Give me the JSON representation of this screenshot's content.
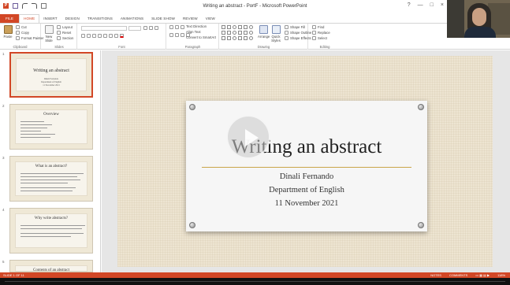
{
  "window": {
    "title": "Writing an abstract - PortF - Microsoft PowerPoint",
    "app_icon": "P",
    "controls": [
      "?",
      "—",
      "□",
      "×"
    ]
  },
  "ribbon": {
    "tabs": [
      "FILE",
      "HOME",
      "INSERT",
      "DESIGN",
      "TRANSITIONS",
      "ANIMATIONS",
      "SLIDE SHOW",
      "REVIEW",
      "VIEW"
    ],
    "active_tab": "HOME",
    "clipboard": {
      "paste": "Paste",
      "cut": "Cut",
      "copy": "Copy",
      "format_painter": "Format Painter",
      "label": "Clipboard"
    },
    "slides": {
      "new_slide": "New Slide",
      "layout": "Layout",
      "reset": "Reset",
      "section": "Section",
      "label": "Slides"
    },
    "font": {
      "label": "Font"
    },
    "paragraph": {
      "text_direction": "Text Direction",
      "align_text": "Align Text",
      "convert_smartart": "Convert to SmartArt",
      "label": "Paragraph"
    },
    "drawing": {
      "arrange": "Arrange",
      "quick_styles": "Quick Styles",
      "shape_fill": "Shape Fill",
      "shape_outline": "Shape Outline",
      "shape_effects": "Shape Effects",
      "label": "Drawing"
    },
    "editing": {
      "find": "Find",
      "replace": "Replace",
      "select": "Select",
      "label": "Editing"
    }
  },
  "thumbnails": [
    {
      "num": "1",
      "title": "Writing an abstract",
      "sub": [
        "Dinali Fernando",
        "Department of English",
        "11 November 2021"
      ]
    },
    {
      "num": "2",
      "title": "Overview"
    },
    {
      "num": "3",
      "title": "What is an abstract?"
    },
    {
      "num": "4",
      "title": "Why write abstracts?"
    },
    {
      "num": "5",
      "title": "Contents of an abstract"
    }
  ],
  "slide": {
    "title": "Writing an abstract",
    "author": "Dinali Fernando",
    "department": "Department of English",
    "date": "11 November 2021"
  },
  "statusbar": {
    "slide_info": "SLIDE 1 OF 11",
    "notes": "NOTES",
    "comments": "COMMENTS",
    "zoom": "118%"
  },
  "colors": {
    "accent": "#d24726",
    "slide_bg": "#ede4d1",
    "rule": "#c9a54a"
  }
}
